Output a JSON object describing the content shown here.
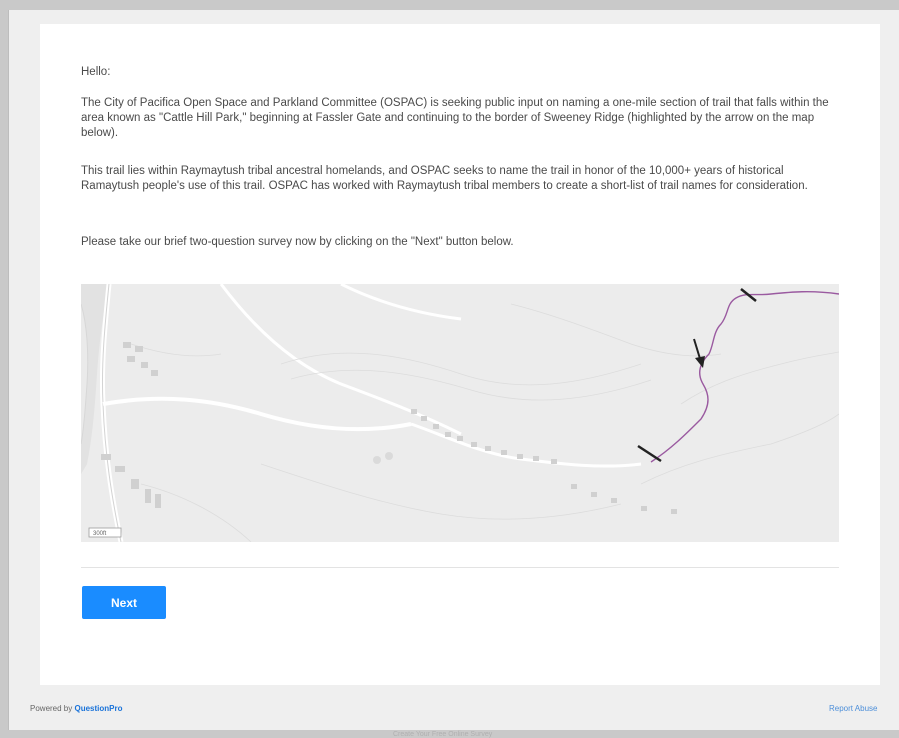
{
  "survey": {
    "greeting": "Hello:",
    "paragraphs": [
      "The City of Pacifica Open Space and Parkland Committee (OSPAC) is seeking public input on naming a one-mile section of trail that falls within the area known as \"Cattle Hill Park,\" beginning at Fassler Gate and continuing to the border of Sweeney Ridge (highlighted by the arrow on the map below).",
      "This trail lies within Raymaytush tribal ancestral homelands, and OSPAC seeks to name the trail in honor of the 10,000+ years of historical Ramaytush people's use of this trail.  OSPAC has worked with Raymaytush tribal members to create a short-list of trail names for consideration.",
      "Please take our brief two-question survey now by clicking on the \"Next\" button below."
    ],
    "next_label": "Next"
  },
  "map": {
    "scale_label": "300ft",
    "trail_color": "#9a5aa0",
    "background_color": "#ececec"
  },
  "footer": {
    "powered_prefix": "Powered by",
    "brand": "QuestionPro",
    "report_abuse": "Report Abuse",
    "create_survey": "Create Your Free Online Survey"
  }
}
